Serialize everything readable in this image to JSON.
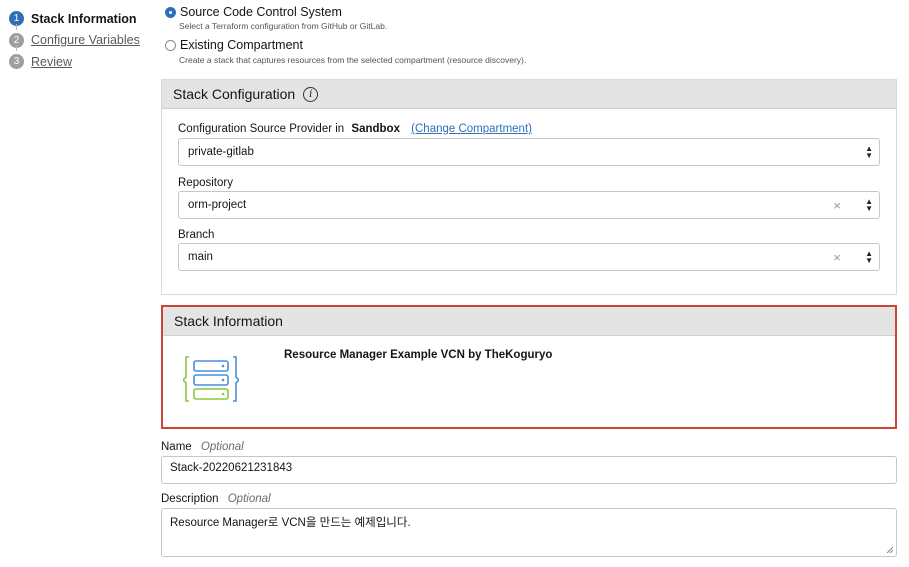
{
  "steps": [
    {
      "number": "1",
      "label": "Stack Information",
      "state": "active"
    },
    {
      "number": "2",
      "label": "Configure Variables",
      "state": "link"
    },
    {
      "number": "3",
      "label": "Review",
      "state": "link"
    }
  ],
  "source_options": [
    {
      "label": "Source Code Control System",
      "description": "Select a Terraform configuration from GitHub or GitLab.",
      "checked": true
    },
    {
      "label": "Existing Compartment",
      "description": "Create a stack that captures resources from the selected compartment (resource discovery).",
      "checked": false
    }
  ],
  "stack_configuration": {
    "title": "Stack Configuration",
    "info_icon": "i",
    "provider_label": "Configuration Source Provider in",
    "compartment": "Sandbox",
    "change_link": "(Change Compartment)",
    "provider_value": "private-gitlab",
    "repository_label": "Repository",
    "repository_value": "orm-project",
    "branch_label": "Branch",
    "branch_value": "main",
    "clear_glyph": "×",
    "updown_up": "▲",
    "updown_down": "▼"
  },
  "stack_information": {
    "title": "Stack Information",
    "stack_name": "Resource Manager Example VCN by TheKoguryo",
    "icon": "stack-server-icon"
  },
  "name_field": {
    "label": "Name",
    "optional": "Optional",
    "value": "Stack-20220621231843"
  },
  "description_field": {
    "label": "Description",
    "optional": "Optional",
    "value": "Resource Manager로 VCN을 만드는 예제입니다."
  },
  "colors": {
    "accent": "#2f6fb8",
    "highlight_border": "#c74634",
    "icon_blue": "#4a90d9",
    "icon_green": "#8dc63f"
  }
}
